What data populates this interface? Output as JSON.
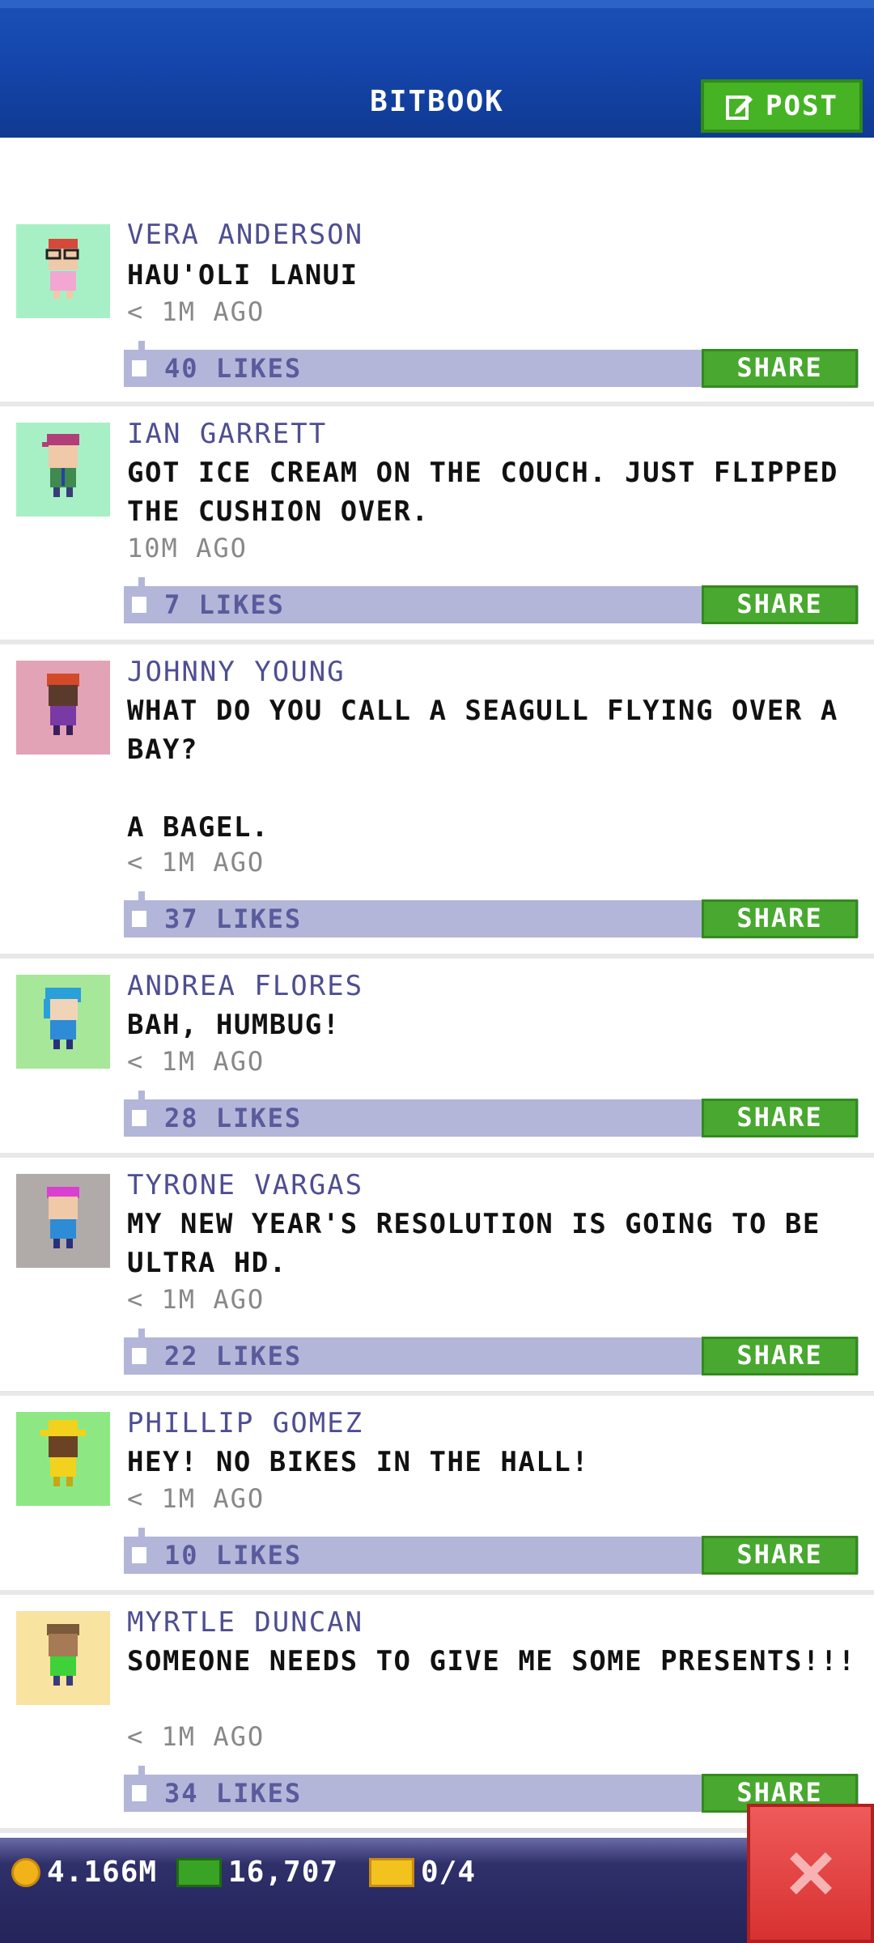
{
  "header": {
    "title": "BITBOOK",
    "post_label": "POST"
  },
  "feed": [
    {
      "name": "VERA ANDERSON",
      "text": "HAU'OLI LANUI",
      "time": "< 1M AGO",
      "likes": "40 LIKES",
      "share_label": "SHARE",
      "avatar_bg": "#a7f0c6"
    },
    {
      "name": "IAN GARRETT",
      "text": "GOT ICE CREAM ON THE COUCH. JUST FLIPPED THE CUSHION OVER.",
      "time": "10M AGO",
      "likes": "7 LIKES",
      "share_label": "SHARE",
      "avatar_bg": "#a7f0c6"
    },
    {
      "name": "JOHNNY YOUNG",
      "text": "WHAT DO YOU CALL A SEAGULL FLYING OVER A BAY?\n\nA BAGEL.",
      "time": "< 1M AGO",
      "likes": "37 LIKES",
      "share_label": "SHARE",
      "avatar_bg": "#e3a3b6"
    },
    {
      "name": "ANDREA FLORES",
      "text": "BAH, HUMBUG!",
      "time": "< 1M AGO",
      "likes": "28 LIKES",
      "share_label": "SHARE",
      "avatar_bg": "#a6e79a"
    },
    {
      "name": "TYRONE VARGAS",
      "text": "MY NEW YEAR'S RESOLUTION IS GOING TO BE ULTRA HD.",
      "time": "< 1M AGO",
      "likes": "22 LIKES",
      "share_label": "SHARE",
      "avatar_bg": "#b0aba8"
    },
    {
      "name": "PHILLIP GOMEZ",
      "text": "HEY! NO BIKES IN THE HALL!",
      "time": "< 1M AGO",
      "likes": "10 LIKES",
      "share_label": "SHARE",
      "avatar_bg": "#8de883"
    },
    {
      "name": "MYRTLE DUNCAN",
      "text": "SOMEONE NEEDS TO GIVE ME SOME PRESENTS!!!",
      "time": "< 1M AGO",
      "likes": "34 LIKES",
      "share_label": "SHARE",
      "avatar_bg": "#f8e3a1"
    }
  ],
  "bottom_bar": {
    "coins": "4.166M",
    "bux": "16,707",
    "tickets": "0/4"
  },
  "colors": {
    "header_blue": "#1546ac",
    "share_green": "#48a82f",
    "likes_bar": "#b3b6d8",
    "name_color": "#4e4e92",
    "close_red": "#d83131"
  },
  "icons": {
    "post": "edit-icon",
    "like": "thumbs-up-icon",
    "coin": "coin-icon",
    "bux": "cash-icon",
    "tickets": "ticket-icon",
    "close": "close-icon"
  }
}
